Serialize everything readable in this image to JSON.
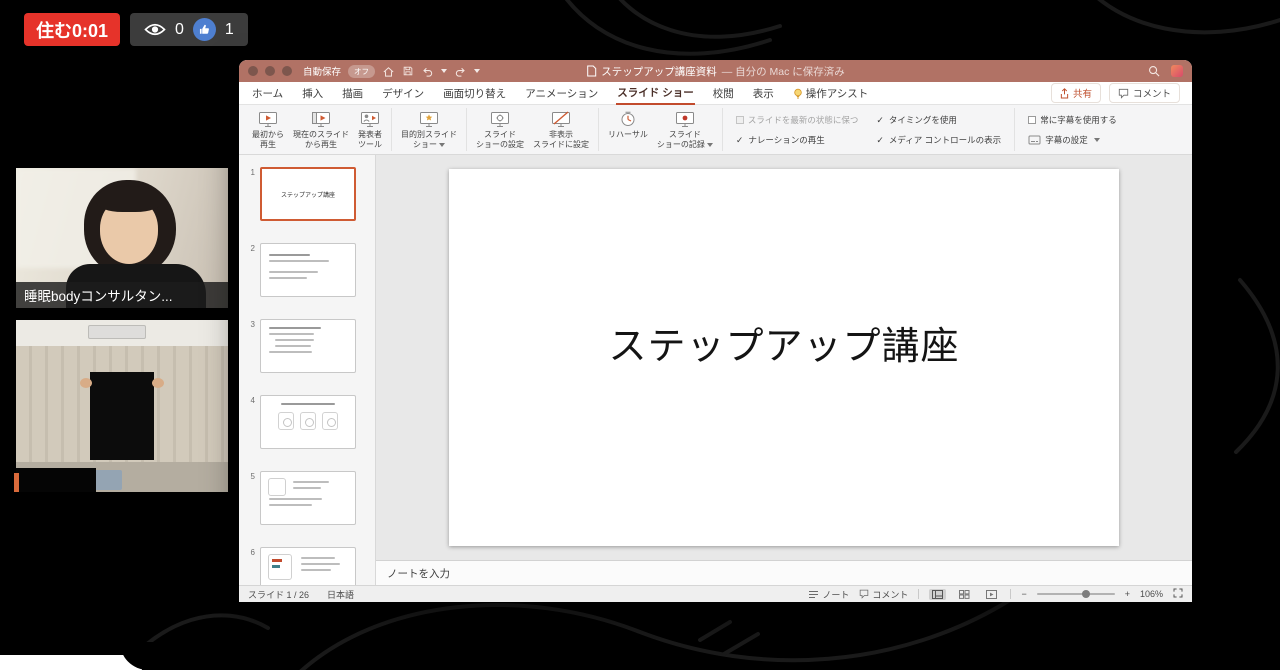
{
  "stream": {
    "timer": "住む0:01",
    "view_count": "0",
    "like_count": "1",
    "presenter_name": "睡眠bodyコンサルタン..."
  },
  "window": {
    "autosave": "自動保存",
    "autosave_state": "オフ",
    "doc_title": "ステップアップ講座資料",
    "saved_state": "— 自分の Mac に保存済み"
  },
  "tabs": [
    "ホーム",
    "挿入",
    "描画",
    "デザイン",
    "画面切り替え",
    "アニメーション",
    "スライド ショー",
    "校閲",
    "表示",
    "操作アシスト"
  ],
  "selected_tab": "スライド ショー",
  "actions": {
    "share": "共有",
    "comment": "コメント"
  },
  "ribbon": {
    "play_from_start": "最初から\n再生",
    "play_from_current": "現在のスライド\nから再生",
    "presenter_tools": "発表者\nツール",
    "custom_show": "目的別スライド\nショー",
    "setup_show": "スライド\nショーの設定",
    "hide_slide": "非表示\nスライドに設定",
    "rehearse": "リハーサル",
    "record_show": "スライド\nショーの記録",
    "keep_updated": "スライドを最新の状態に保つ",
    "play_narration": "ナレーションの再生",
    "use_timings": "タイミングを使用",
    "show_media_controls": "メディア コントロールの表示",
    "always_subtitles": "常に字幕を使用する",
    "subtitle_settings": "字幕の設定"
  },
  "thumbnails": {
    "numbers": [
      "1",
      "2",
      "3",
      "4",
      "5",
      "6"
    ],
    "slide1_text": "ステップアップ講座"
  },
  "slide": {
    "title": "ステップアップ講座"
  },
  "notes": {
    "placeholder": "ノートを入力"
  },
  "statusbar": {
    "slide_counter": "スライド 1 / 26",
    "language": "日本語",
    "notes_label": "ノート",
    "comments_label": "コメント",
    "zoom_out": "−",
    "zoom_in": "+",
    "zoom_level": "106%"
  },
  "icons": {
    "views": "eye",
    "likes": "thumbs-up",
    "assist": "lightbulb",
    "share": "arrow-up-share",
    "comment": "speech-bubble",
    "search": "magnifier"
  },
  "colors": {
    "live_red": "#e6332a",
    "like_blue": "#4e7fd0",
    "titlebar": "#b17265",
    "accent_orange": "#c24b2d"
  }
}
